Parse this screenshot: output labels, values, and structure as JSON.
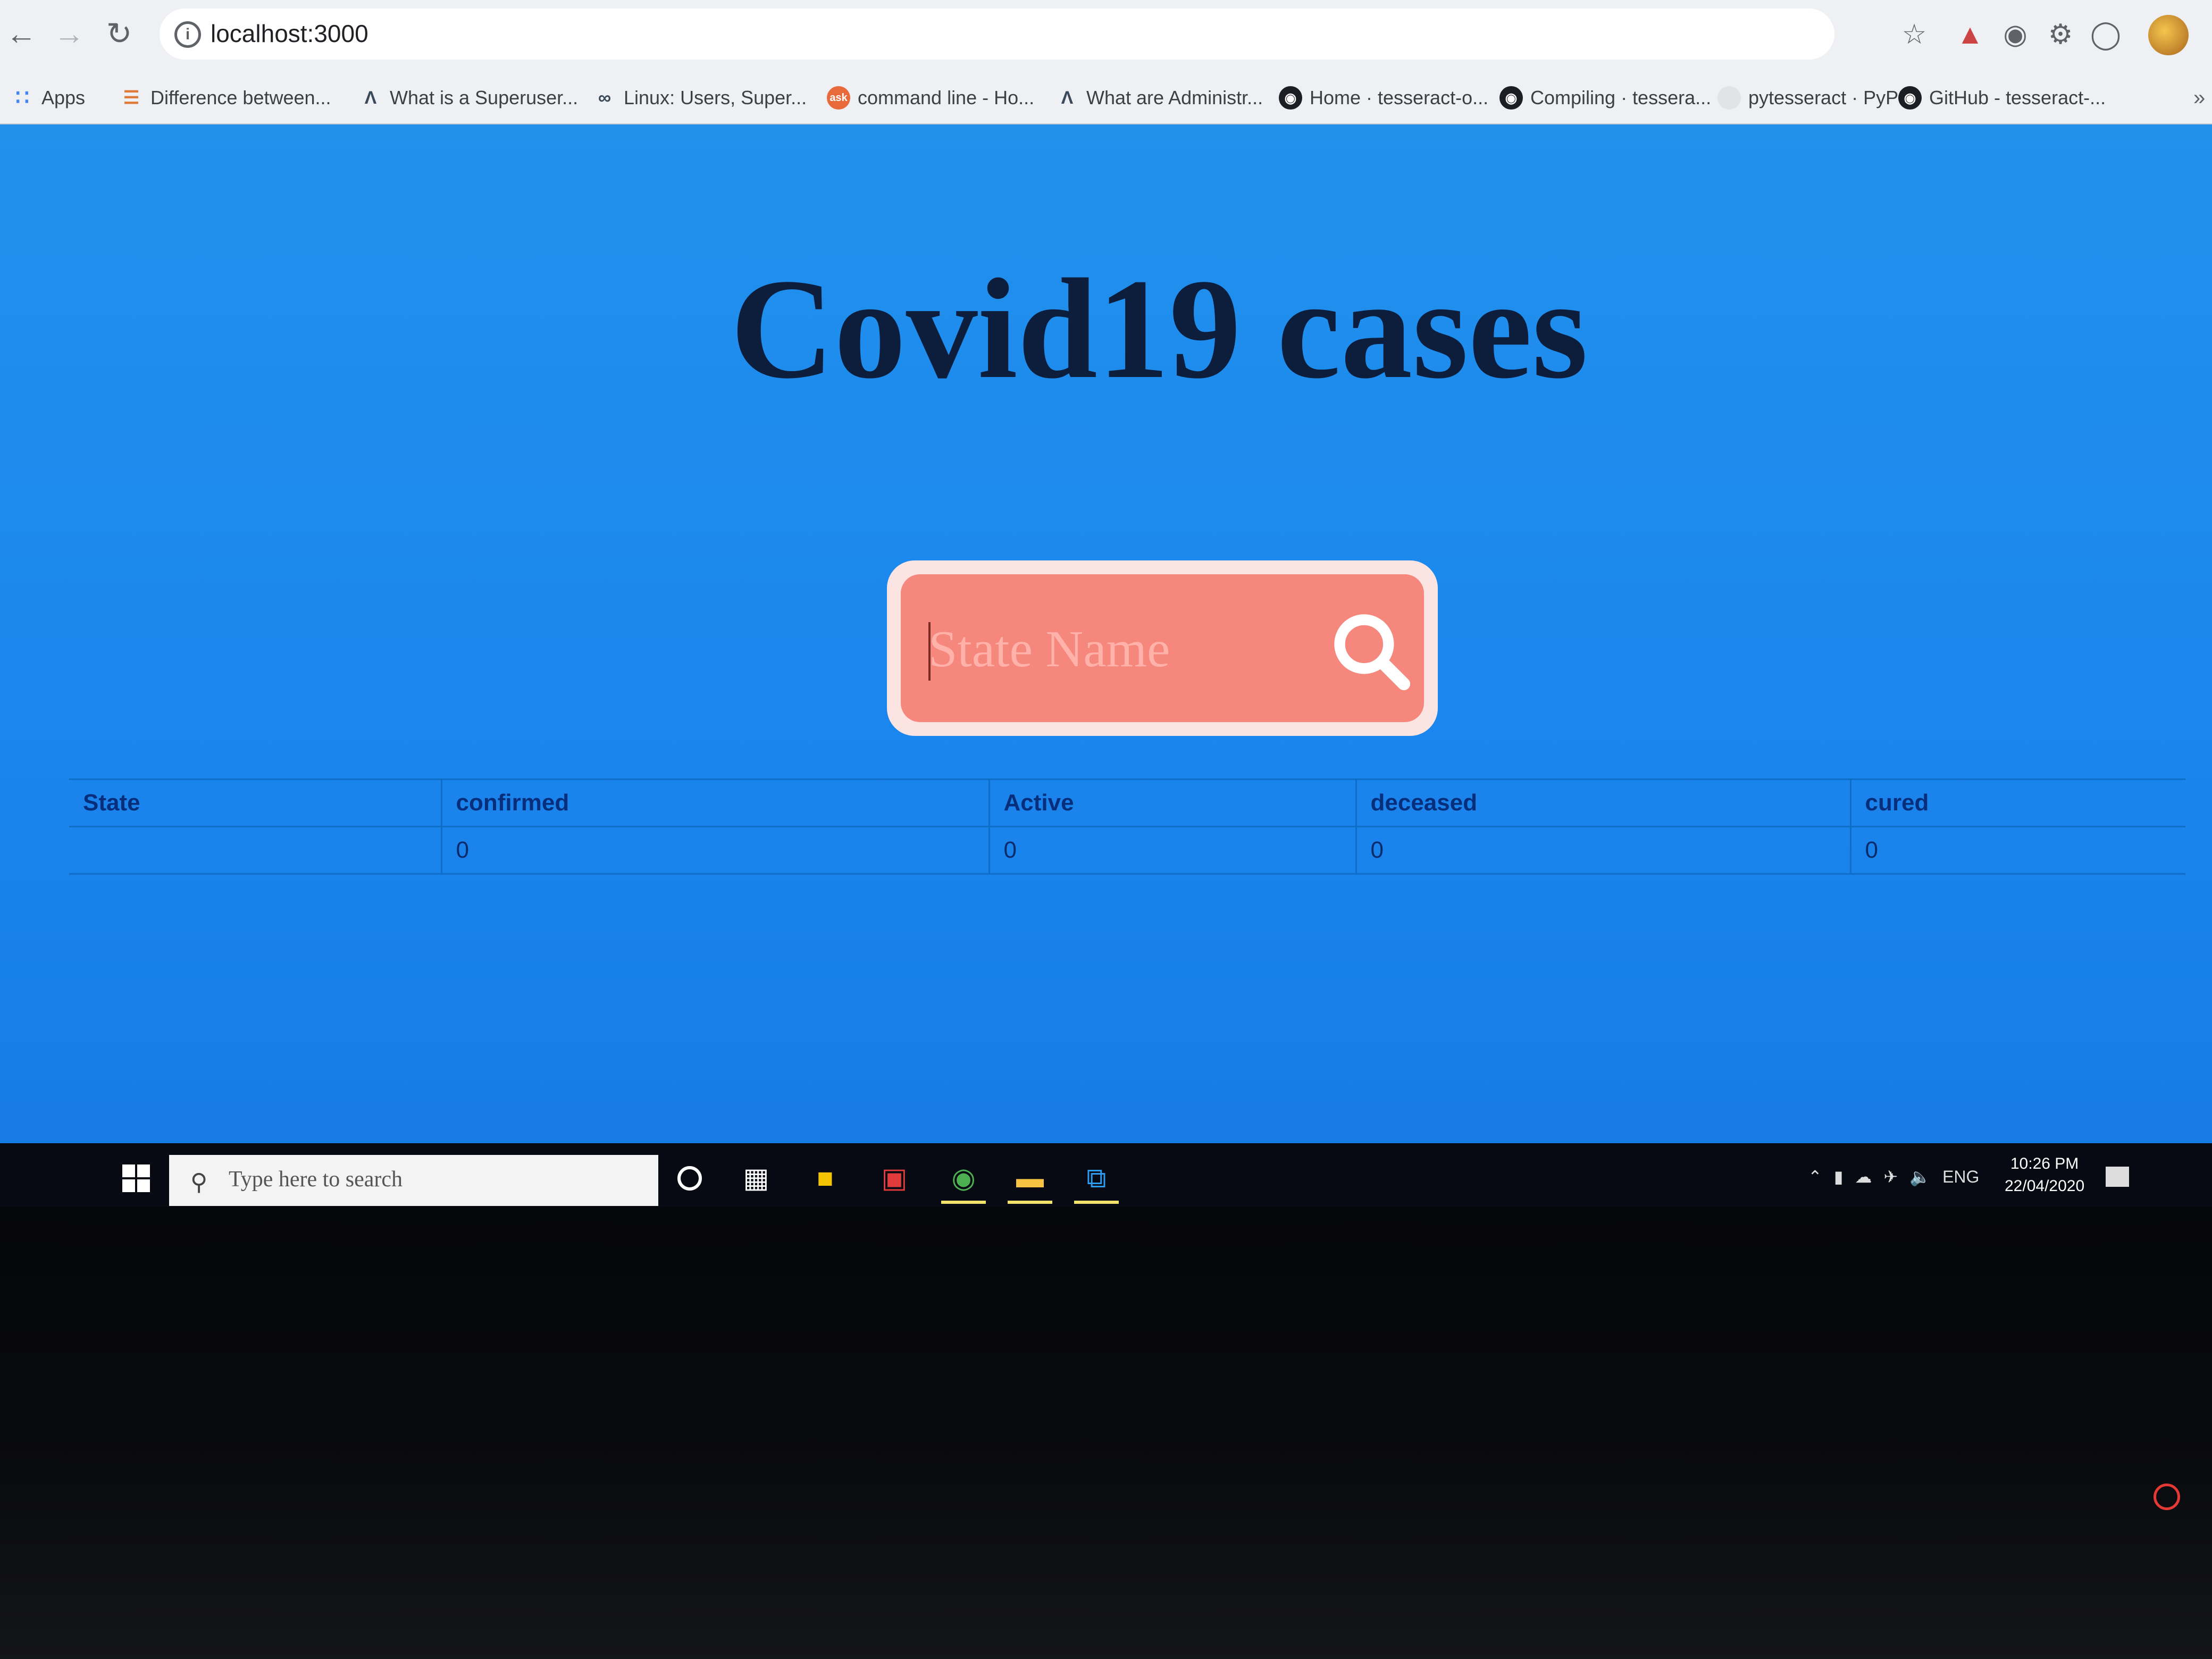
{
  "browser": {
    "url": "localhost:3000",
    "bookmarks": [
      {
        "label": "Apps",
        "icon": "apps-grid-icon"
      },
      {
        "label": "Difference between...",
        "icon": "stack-exchange-icon"
      },
      {
        "label": "What is a Superuser...",
        "icon": "triangle-logo-icon"
      },
      {
        "label": "Linux: Users, Super...",
        "icon": "infinity-logo-icon"
      },
      {
        "label": "command line - Ho...",
        "icon": "askubuntu-icon"
      },
      {
        "label": "What are Administr...",
        "icon": "triangle-logo-icon"
      },
      {
        "label": "Home · tesseract-o...",
        "icon": "github-icon"
      },
      {
        "label": "Compiling · tessera...",
        "icon": "github-icon"
      },
      {
        "label": "pytesseract · PyPI",
        "icon": "pypi-icon"
      },
      {
        "label": "GitHub - tesseract-...",
        "icon": "github-icon"
      }
    ]
  },
  "page": {
    "title": "Covid19 cases",
    "search": {
      "placeholder": "State Name",
      "value": ""
    },
    "table": {
      "headers": [
        "State",
        "confirmed",
        "Active",
        "deceased",
        "cured"
      ],
      "row": [
        "",
        "0",
        "0",
        "0",
        "0"
      ]
    }
  },
  "taskbar": {
    "search_placeholder": "Type here to search",
    "language": "ENG",
    "time": "10:26 PM",
    "date": "22/04/2020"
  },
  "colors": {
    "page_background": "#1b86ee",
    "title": "#0d1d3c",
    "search_box": "#f6877c",
    "search_border": "#fbe4e1",
    "table_header_text": "#072e7a"
  }
}
